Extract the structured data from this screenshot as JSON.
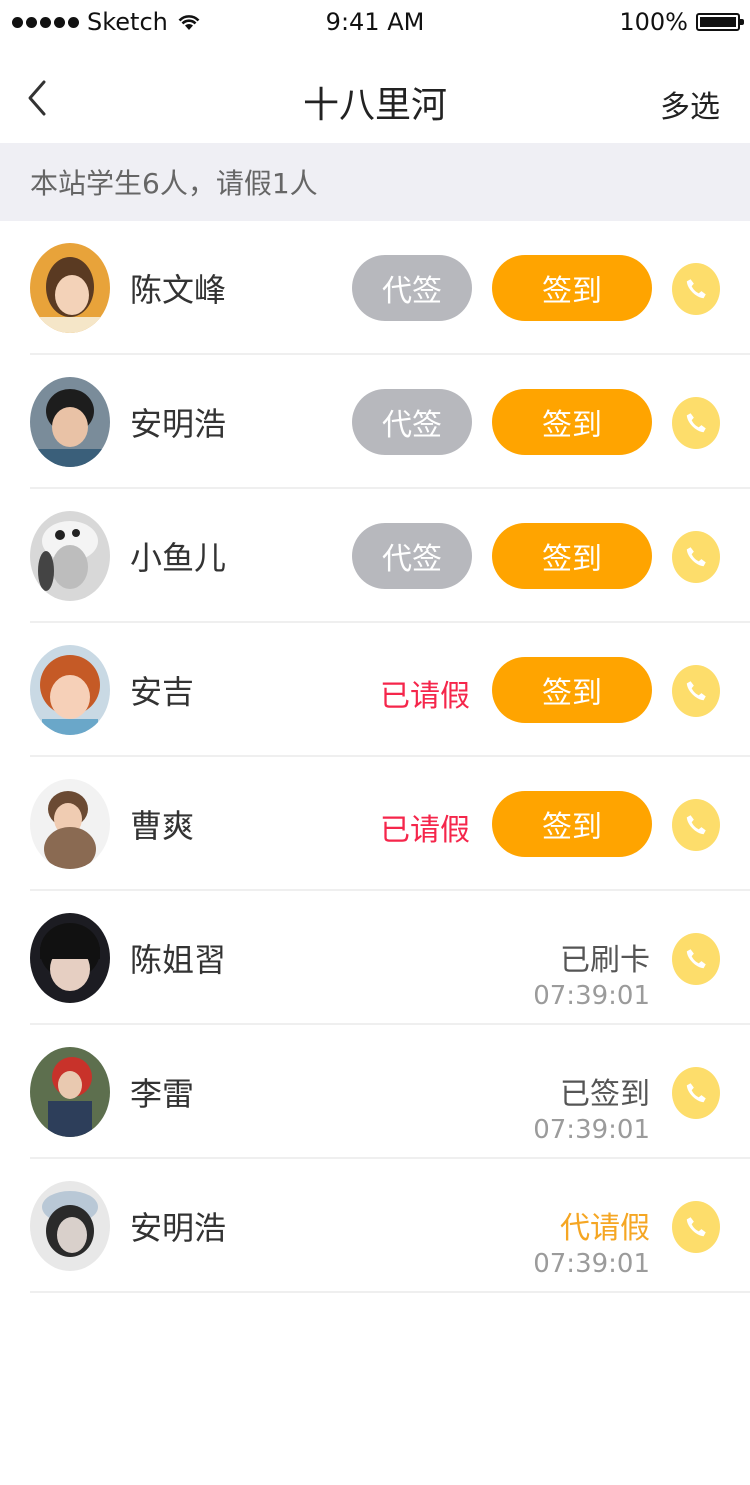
{
  "status_bar": {
    "carrier": "Sketch",
    "time": "9:41 AM",
    "battery": "100%"
  },
  "nav": {
    "title": "十八里河",
    "multi_select": "多选"
  },
  "summary": "本站学生6人，请假1人",
  "labels": {
    "proxy": "代签",
    "sign_in": "签到",
    "on_leave": "已请假"
  },
  "colors": {
    "accent": "#ffa400",
    "proxy_button": "#b7b8bd",
    "leave_red": "#f5264b",
    "phone_yellow": "#fddd6b",
    "proxy_leave_orange": "#f5a623"
  },
  "students": [
    {
      "name": "陈文峰",
      "state": "pending"
    },
    {
      "name": "安明浩",
      "state": "pending"
    },
    {
      "name": "小鱼儿",
      "state": "pending"
    },
    {
      "name": "安吉",
      "state": "leave"
    },
    {
      "name": "曹爽",
      "state": "leave"
    },
    {
      "name": "陈姐習",
      "state": "done",
      "status": "已刷卡",
      "time": "07:39:01"
    },
    {
      "name": "李雷",
      "state": "done",
      "status": "已签到",
      "time": "07:39:01"
    },
    {
      "name": "安明浩",
      "state": "proxyleave",
      "status": "代请假",
      "time": "07:39:01"
    }
  ]
}
